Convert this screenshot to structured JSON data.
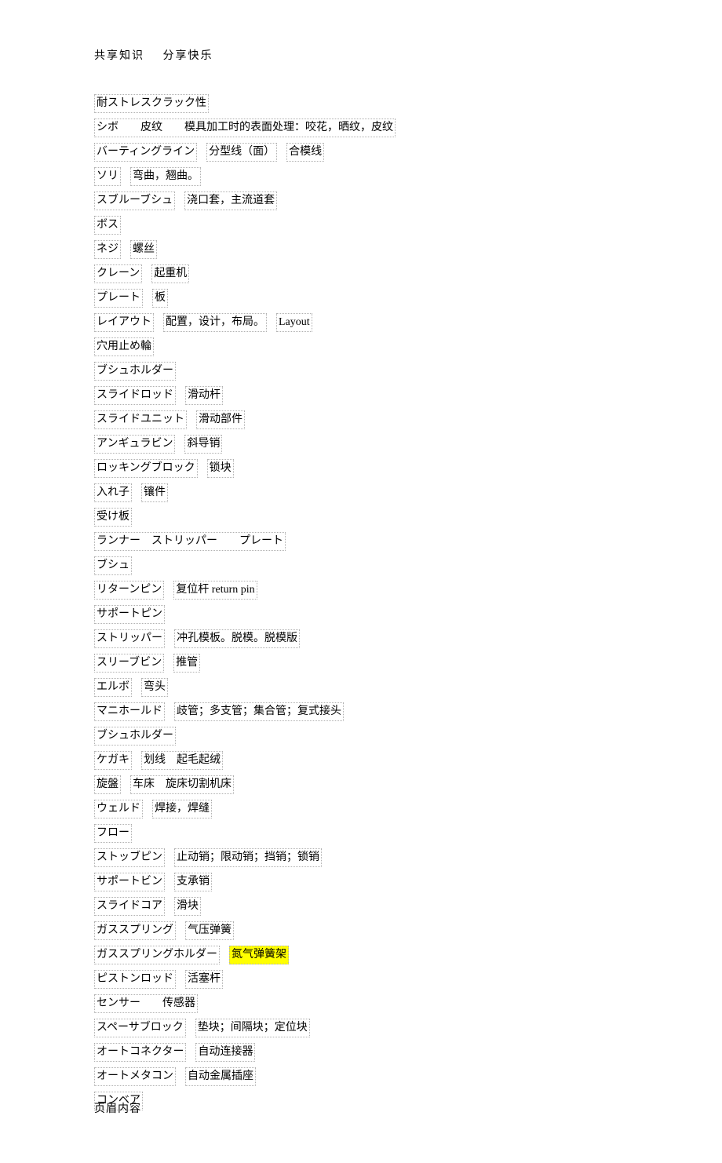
{
  "header": {
    "part1": "共享知识",
    "part2": "分享快乐"
  },
  "footer": "页眉内容",
  "rows": [
    {
      "segs": [
        {
          "t": "耐ストレスクラック性"
        }
      ]
    },
    {
      "segs": [
        {
          "t": "シボ　　皮纹　　模具加工时的表面处理：咬花，晒纹，皮纹"
        }
      ]
    },
    {
      "segs": [
        {
          "t": "バーティングライン"
        },
        {
          "t": "分型线（面）"
        },
        {
          "t": "合模线"
        }
      ]
    },
    {
      "segs": [
        {
          "t": "ソリ "
        },
        {
          "t": "弯曲，翘曲。"
        }
      ]
    },
    {
      "segs": [
        {
          "t": "スブルーブシュ "
        },
        {
          "t": "浇口套，主流道套"
        }
      ]
    },
    {
      "segs": [
        {
          "t": "ボス"
        }
      ]
    },
    {
      "segs": [
        {
          "t": "ネジ "
        },
        {
          "t": "螺丝"
        }
      ]
    },
    {
      "segs": [
        {
          "t": "クレーン "
        },
        {
          "t": "起重机"
        }
      ]
    },
    {
      "segs": [
        {
          "t": "プレート "
        },
        {
          "t": "板"
        }
      ]
    },
    {
      "segs": [
        {
          "t": "レイアウト "
        },
        {
          "t": "配置，设计，布局。"
        },
        {
          "t": "Layout"
        }
      ]
    },
    {
      "segs": [
        {
          "t": "穴用止め輪"
        }
      ]
    },
    {
      "segs": [
        {
          "t": "ブシュホルダー"
        }
      ]
    },
    {
      "segs": [
        {
          "t": "スライドロッド "
        },
        {
          "t": "滑动杆"
        }
      ]
    },
    {
      "segs": [
        {
          "t": "スライドユニット "
        },
        {
          "t": "滑动部件"
        }
      ]
    },
    {
      "segs": [
        {
          "t": "アンギュラビン "
        },
        {
          "t": "斜导销"
        }
      ]
    },
    {
      "segs": [
        {
          "t": "ロッキングブロック "
        },
        {
          "t": "锁块"
        }
      ]
    },
    {
      "segs": [
        {
          "t": "入れ子 "
        },
        {
          "t": "镶件"
        }
      ]
    },
    {
      "segs": [
        {
          "t": "受け板"
        }
      ]
    },
    {
      "segs": [
        {
          "t": "ランナー　ストリッパー　　プレート"
        }
      ]
    },
    {
      "segs": [
        {
          "t": "ブシュ"
        }
      ]
    },
    {
      "segs": [
        {
          "t": "リターンピン "
        },
        {
          "t": "复位杆  return pin"
        }
      ]
    },
    {
      "segs": [
        {
          "t": "サポートピン"
        }
      ]
    },
    {
      "segs": [
        {
          "t": "ストリッパー "
        },
        {
          "t": "冲孔模板。脱模。脱模版"
        }
      ]
    },
    {
      "segs": [
        {
          "t": "スリーブビン "
        },
        {
          "t": "推管"
        }
      ]
    },
    {
      "segs": [
        {
          "t": "エルボ "
        },
        {
          "t": "弯头"
        }
      ]
    },
    {
      "segs": [
        {
          "t": "マニホールド "
        },
        {
          "t": "歧管；多支管；集合管；复式接头"
        }
      ]
    },
    {
      "segs": [
        {
          "t": "ブシュホルダー"
        }
      ]
    },
    {
      "segs": [
        {
          "t": "ケガキ "
        },
        {
          "t": "划线　起毛起绒"
        }
      ]
    },
    {
      "segs": [
        {
          "t": "旋盤 "
        },
        {
          "t": "车床　旋床切割机床"
        }
      ]
    },
    {
      "segs": [
        {
          "t": "ウェルド "
        },
        {
          "t": "焊接，焊缝"
        }
      ]
    },
    {
      "segs": [
        {
          "t": "フロー"
        }
      ]
    },
    {
      "segs": [
        {
          "t": "ストッブピン "
        },
        {
          "t": "止动销；限动销；挡销；锁销"
        }
      ]
    },
    {
      "segs": [
        {
          "t": "サポートビン "
        },
        {
          "t": "支承销"
        }
      ]
    },
    {
      "segs": [
        {
          "t": "スライドコア "
        },
        {
          "t": "滑块"
        }
      ]
    },
    {
      "segs": [
        {
          "t": "ガススプリング "
        },
        {
          "t": "气压弹簧"
        }
      ]
    },
    {
      "segs": [
        {
          "t": "ガススプリングホルダー "
        },
        {
          "t": "氮气弹簧架",
          "hl": true
        }
      ]
    },
    {
      "segs": [
        {
          "t": "ピストンロッド "
        },
        {
          "t": "活塞杆"
        }
      ]
    },
    {
      "segs": [
        {
          "t": "センサー　　传感器"
        }
      ]
    },
    {
      "segs": [
        {
          "t": "スペーサブロック "
        },
        {
          "t": "垫块；间隔块；定位块"
        }
      ]
    },
    {
      "segs": [
        {
          "t": "オートコネクター "
        },
        {
          "t": "自动连接器"
        }
      ]
    },
    {
      "segs": [
        {
          "t": "オートメタコン "
        },
        {
          "t": "自动金属插座"
        }
      ]
    },
    {
      "segs": [
        {
          "t": "コンベア"
        }
      ]
    }
  ]
}
